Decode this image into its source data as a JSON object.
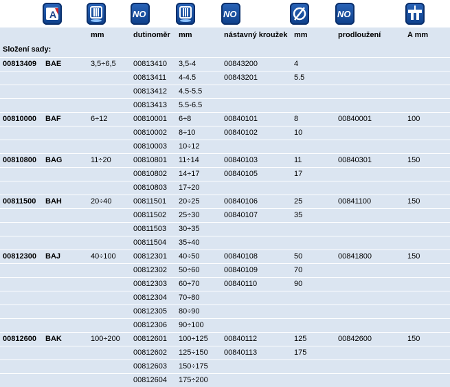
{
  "icons": [
    "user-gauge-icon",
    "comb-icon",
    "no-sign-icon",
    "comb-icon",
    "no-sign-icon",
    "diameter-icon",
    "no-sign-icon",
    "anvil-icon"
  ],
  "icon_texts": {
    "no": "NO",
    "a": "A"
  },
  "headers": {
    "mm1": "mm",
    "dutinomer": "dutinoměr",
    "mm2": "mm",
    "krouzek": "nástavný kroužek",
    "mm3": "mm",
    "prodlouzeni": "prodloužení",
    "amm": "A mm"
  },
  "subtitle": "Složení sady:",
  "rows": [
    [
      "00813409",
      "BAE",
      "3,5÷6,5",
      "00813410",
      "3,5-4",
      "00843200",
      "4",
      "",
      ""
    ],
    [
      "",
      "",
      "",
      "00813411",
      "4-4.5",
      "00843201",
      "5.5",
      "",
      ""
    ],
    [
      "",
      "",
      "",
      "00813412",
      "4.5-5.5",
      "",
      "",
      "",
      ""
    ],
    [
      "",
      "",
      "",
      "00813413",
      "5.5-6.5",
      "",
      "",
      "",
      ""
    ],
    [
      "00810000",
      "BAF",
      "6÷12",
      "00810001",
      "6÷8",
      "00840101",
      "8",
      "00840001",
      "100"
    ],
    [
      "",
      "",
      "",
      "00810002",
      "8÷10",
      "00840102",
      "10",
      "",
      ""
    ],
    [
      "",
      "",
      "",
      "00810003",
      "10÷12",
      "",
      "",
      "",
      ""
    ],
    [
      "00810800",
      "BAG",
      "11÷20",
      "00810801",
      "11÷14",
      "00840103",
      "11",
      "00840301",
      "150"
    ],
    [
      "",
      "",
      "",
      "00810802",
      "14÷17",
      "00840105",
      "17",
      "",
      ""
    ],
    [
      "",
      "",
      "",
      "00810803",
      "17÷20",
      "",
      "",
      "",
      ""
    ],
    [
      "00811500",
      "BAH",
      "20÷40",
      "00811501",
      "20÷25",
      "00840106",
      "25",
      "00841100",
      "150"
    ],
    [
      "",
      "",
      "",
      "00811502",
      "25÷30",
      "00840107",
      "35",
      "",
      ""
    ],
    [
      "",
      "",
      "",
      "00811503",
      "30÷35",
      "",
      "",
      "",
      ""
    ],
    [
      "",
      "",
      "",
      "00811504",
      "35÷40",
      "",
      "",
      "",
      ""
    ],
    [
      "00812300",
      "BAJ",
      "40÷100",
      "00812301",
      "40÷50",
      "00840108",
      "50",
      "00841800",
      "150"
    ],
    [
      "",
      "",
      "",
      "00812302",
      "50÷60",
      "00840109",
      "70",
      "",
      ""
    ],
    [
      "",
      "",
      "",
      "00812303",
      "60÷70",
      "00840110",
      "90",
      "",
      ""
    ],
    [
      "",
      "",
      "",
      "00812304",
      "70÷80",
      "",
      "",
      "",
      ""
    ],
    [
      "",
      "",
      "",
      "00812305",
      "80÷90",
      "",
      "",
      "",
      ""
    ],
    [
      "",
      "",
      "",
      "00812306",
      "90÷100",
      "",
      "",
      "",
      ""
    ],
    [
      "00812600",
      "BAK",
      "100÷200",
      "00812601",
      "100÷125",
      "00840112",
      "125",
      "00842600",
      "150"
    ],
    [
      "",
      "",
      "",
      "00812602",
      "125÷150",
      "00840113",
      "175",
      "",
      ""
    ],
    [
      "",
      "",
      "",
      "00812603",
      "150÷175",
      "",
      "",
      "",
      ""
    ],
    [
      "",
      "",
      "",
      "00812604",
      "175÷200",
      "",
      "",
      "",
      ""
    ]
  ]
}
